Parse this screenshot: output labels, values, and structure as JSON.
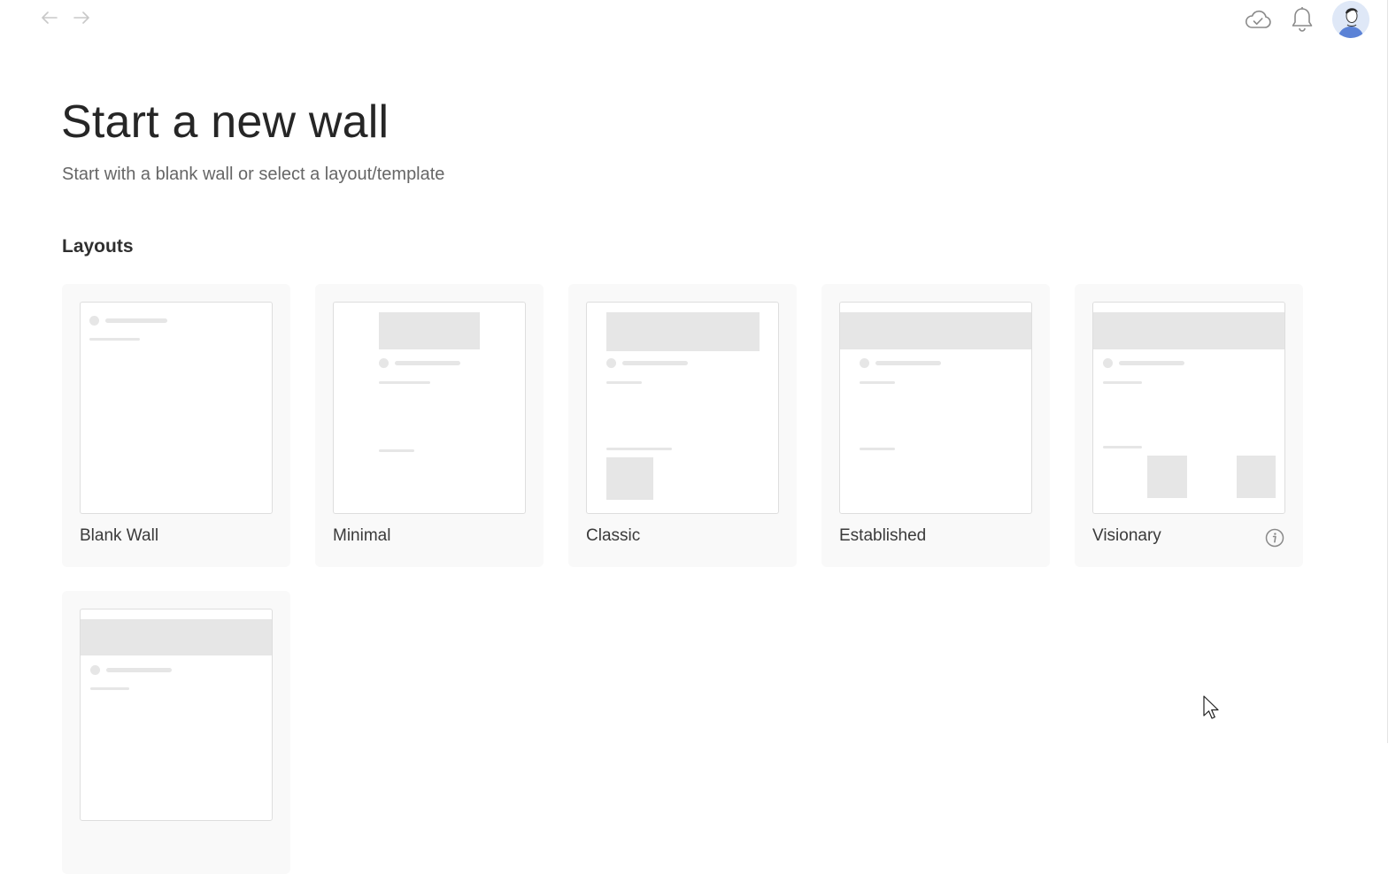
{
  "header": {
    "back_icon": "arrow-left-icon",
    "forward_icon": "arrow-right-icon",
    "cloud_icon": "cloud-check-icon",
    "bell_icon": "bell-icon",
    "avatar_icon": "user-avatar"
  },
  "page": {
    "title": "Start a new wall",
    "subtitle": "Start with a blank wall or select a layout/template"
  },
  "layouts": {
    "heading": "Layouts",
    "items": [
      {
        "label": "Blank Wall"
      },
      {
        "label": "Minimal"
      },
      {
        "label": "Classic"
      },
      {
        "label": "Established"
      },
      {
        "label": "Visionary",
        "info_icon": "info-icon"
      },
      {
        "label": ""
      }
    ]
  },
  "colors": {
    "card_bg": "#f9f9f9",
    "skeleton": "#e6e6e6",
    "title": "#262626",
    "subtitle": "#666666"
  }
}
